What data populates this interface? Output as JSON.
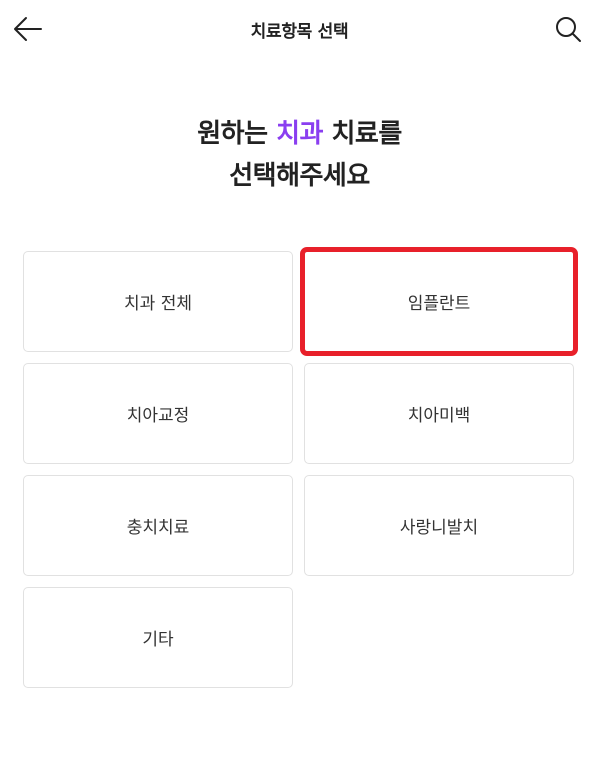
{
  "header": {
    "title": "치료항목 선택",
    "back_icon": "arrow-left-icon",
    "search_icon": "search-icon"
  },
  "headline": {
    "line1_pre": "원하는",
    "line1_accent": "치과",
    "line1_post": "치료를",
    "line2": "선택해주세요"
  },
  "colors": {
    "accent": "#8a3ef0",
    "highlight": "#e8202a"
  },
  "categories": [
    {
      "label": "치과 전체",
      "selected": false
    },
    {
      "label": "임플란트",
      "selected": true
    },
    {
      "label": "치아교정",
      "selected": false
    },
    {
      "label": "치아미백",
      "selected": false
    },
    {
      "label": "충치치료",
      "selected": false
    },
    {
      "label": "사랑니발치",
      "selected": false
    },
    {
      "label": "기타",
      "selected": false
    }
  ]
}
